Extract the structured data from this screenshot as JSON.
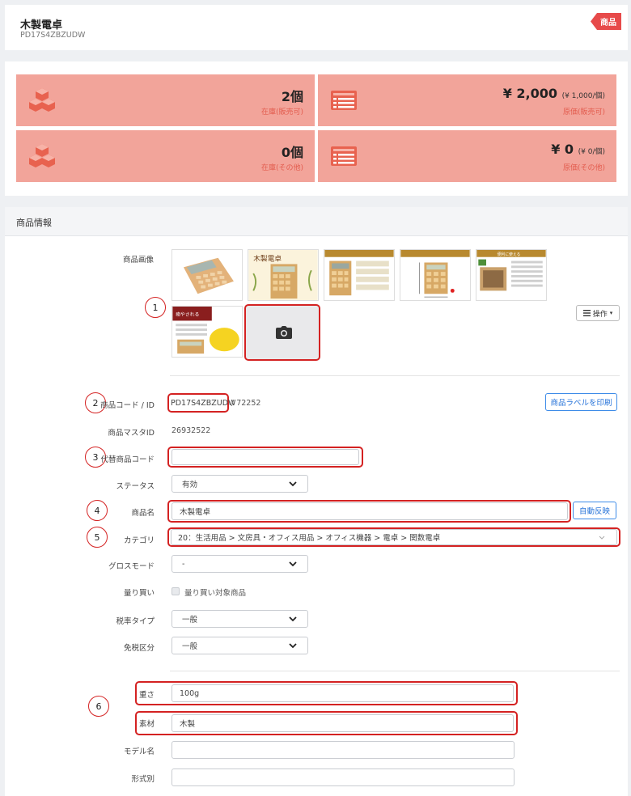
{
  "header": {
    "title": "木製電卓",
    "code": "PD17S4ZBZUDW",
    "ribbon": "商品"
  },
  "stats": [
    {
      "value": "2個",
      "sub": "在庫(販売可)",
      "icon": "cubes-icon"
    },
    {
      "value": "¥ 2,000",
      "unit": "(¥ 1,000/個)",
      "sub": "原価(販売可)",
      "icon": "list-icon"
    },
    {
      "value": "0個",
      "sub": "在庫(その他)",
      "icon": "cubes-icon"
    },
    {
      "value": "¥ 0",
      "unit": "(¥ 0/個)",
      "sub": "原価(その他)",
      "icon": "list-icon"
    }
  ],
  "info": {
    "section_title": "商品情報",
    "images_label": "商品画像",
    "operations_button": "操作",
    "code_label": "商品コード / ID",
    "code_value": "PD17S4ZBZUDW",
    "id_value": "/ 72252",
    "print_label_button": "商品ラベルを印刷",
    "master_id_label": "商品マスタID",
    "master_id_value": "26932522",
    "alt_code_label": "代替商品コード",
    "alt_code_value": "",
    "status_label": "ステータス",
    "status_value": "有効",
    "name_label": "商品名",
    "name_value": "木製電卓",
    "auto_reflect_button": "自動反映",
    "category_label": "カテゴリ",
    "category_value": "20：生活用品 > 文房具・オフィス用品 > オフィス機器 > 電卓 > 関数電卓",
    "gross_label": "グロスモード",
    "gross_value": "-",
    "bulk_label": "量り買い",
    "bulk_checkbox_label": "量り買い対象商品",
    "tax_label": "税率タイプ",
    "tax_value": "一般",
    "exempt_label": "免税区分",
    "exempt_value": "一般",
    "weight_label": "重さ",
    "weight_value": "100g",
    "material_label": "素材",
    "material_value": "木製",
    "model_label": "モデル名",
    "model_value": "",
    "form_label": "形式別",
    "form_value": ""
  },
  "thumbnails": {
    "t2_text": "木製電卓",
    "t5_text": "便利に使える",
    "t6_text": "癒やされる"
  },
  "annotations": [
    "1",
    "2",
    "3",
    "4",
    "5",
    "6"
  ],
  "colors": {
    "stat_tile": "#f2a49a",
    "stat_sub_text": "#e35d4f",
    "ribbon": "#e74a4a",
    "annotation_red": "#d42222",
    "link_blue": "#2673d9"
  }
}
